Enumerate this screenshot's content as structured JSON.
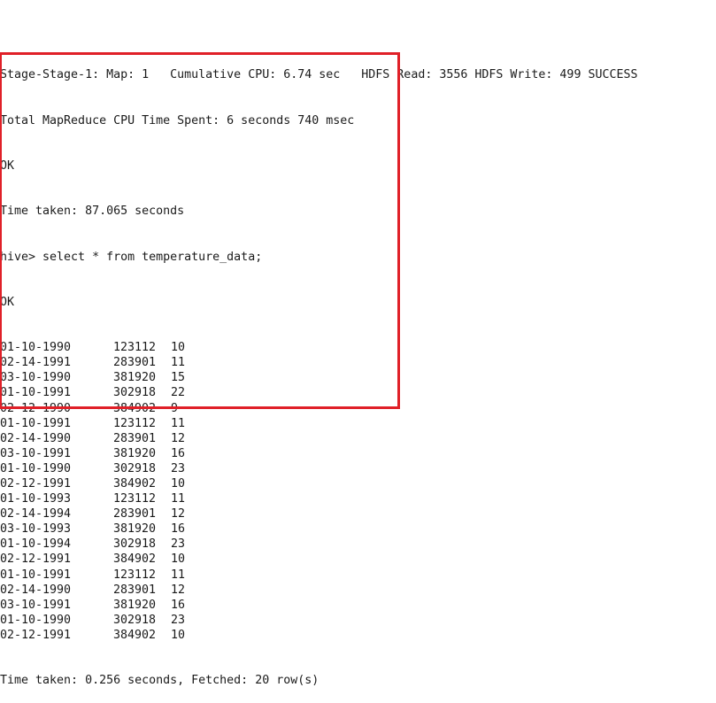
{
  "terminal": {
    "pre_lines": [
      "Stage-Stage-1: Map: 1   Cumulative CPU: 6.74 sec   HDFS Read: 3556 HDFS Write: 499 SUCCESS",
      "Total MapReduce CPU Time Spent: 6 seconds 740 msec",
      "OK",
      "Time taken: 87.065 seconds"
    ],
    "prompt": "hive> select * from temperature_data;",
    "ok": "OK",
    "rows": [
      [
        "01-10-1990",
        "123112",
        "10"
      ],
      [
        "02-14-1991",
        "283901",
        "11"
      ],
      [
        "03-10-1990",
        "381920",
        "15"
      ],
      [
        "01-10-1991",
        "302918",
        "22"
      ],
      [
        "02-12-1990",
        "384902",
        "9"
      ],
      [
        "01-10-1991",
        "123112",
        "11"
      ],
      [
        "02-14-1990",
        "283901",
        "12"
      ],
      [
        "03-10-1991",
        "381920",
        "16"
      ],
      [
        "01-10-1990",
        "302918",
        "23"
      ],
      [
        "02-12-1991",
        "384902",
        "10"
      ],
      [
        "01-10-1993",
        "123112",
        "11"
      ],
      [
        "02-14-1994",
        "283901",
        "12"
      ],
      [
        "03-10-1993",
        "381920",
        "16"
      ],
      [
        "01-10-1994",
        "302918",
        "23"
      ],
      [
        "02-12-1991",
        "384902",
        "10"
      ],
      [
        "01-10-1991",
        "123112",
        "11"
      ],
      [
        "02-14-1990",
        "283901",
        "12"
      ],
      [
        "03-10-1991",
        "381920",
        "16"
      ],
      [
        "01-10-1990",
        "302918",
        "23"
      ],
      [
        "02-12-1991",
        "384902",
        "10"
      ]
    ],
    "footer": "Time taken: 0.256 seconds, Fetched: 20 row(s)"
  },
  "colors": {
    "text": "#1a1a1a",
    "background": "#ffffff",
    "highlight_border": "#e02028"
  }
}
